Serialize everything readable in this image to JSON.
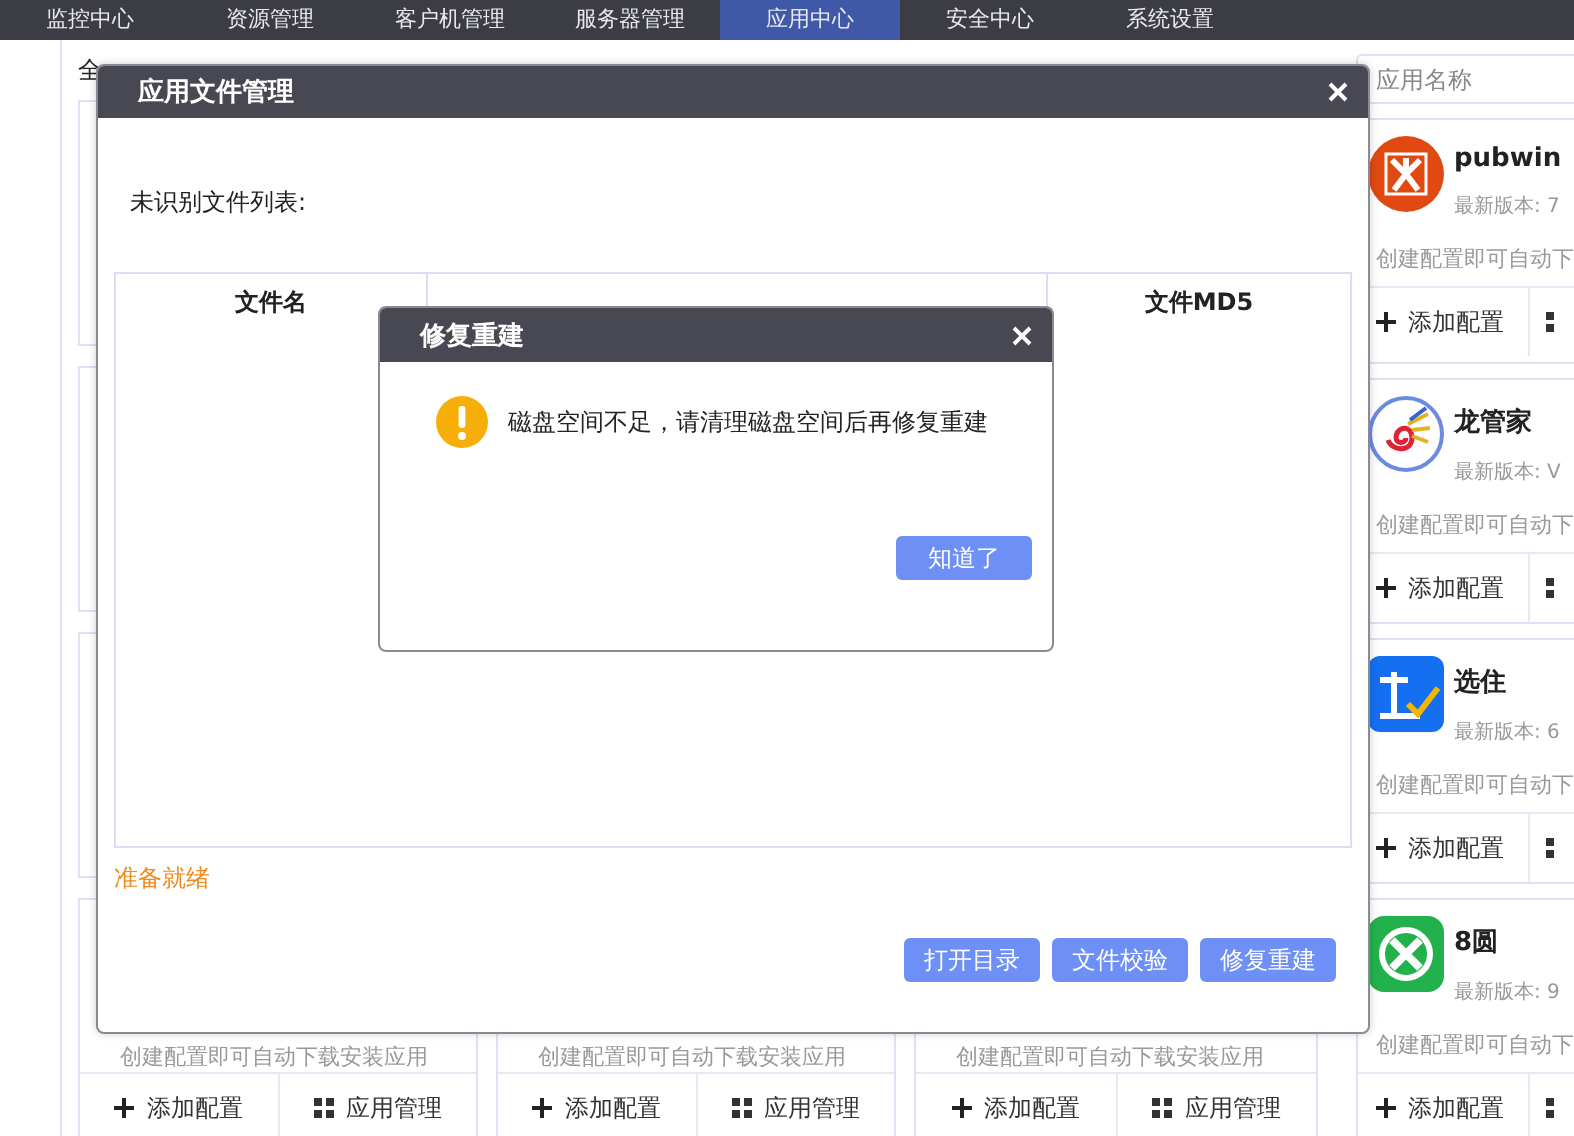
{
  "nav": {
    "items": [
      {
        "label": "监控中心",
        "selected": false
      },
      {
        "label": "资源管理",
        "selected": false
      },
      {
        "label": "客户机管理",
        "selected": false
      },
      {
        "label": "服务器管理",
        "selected": false
      },
      {
        "label": "应用中心",
        "selected": true
      },
      {
        "label": "安全中心",
        "selected": false
      },
      {
        "label": "系统设置",
        "selected": false
      }
    ]
  },
  "filter_label": "全",
  "back_cards": [
    {
      "description": "创建配置即可自动下载安装应用",
      "buttons": [
        "添加配置",
        "应用管理"
      ]
    },
    {
      "description": "创建配置即可自动下载安装应用",
      "buttons": [
        "添加配置",
        "应用管理"
      ]
    },
    {
      "description": "创建配置即可自动下载安装应用",
      "buttons": [
        "添加配置",
        "应用管理"
      ]
    }
  ],
  "search": {
    "placeholder": "应用名称"
  },
  "apps": [
    {
      "kind": "pubwin",
      "name": "pubwin",
      "version": "最新版本: 7",
      "description": "创建配置即可自动下",
      "button": "添加配置"
    },
    {
      "kind": "dragon",
      "name": "龙管家",
      "version": "最新版本: V",
      "description": "创建配置即可自动下",
      "button": "添加配置"
    },
    {
      "kind": "check",
      "name": "选住",
      "version": "最新版本: 6",
      "description": "创建配置即可自动下",
      "button": "添加配置"
    },
    {
      "kind": "green",
      "name": "8圆",
      "version": "最新版本: 9",
      "description": "创建配置即可自动下",
      "button": "添加配置"
    }
  ],
  "file_dialog": {
    "title": "应用文件管理",
    "list_label": "未识别文件列表:",
    "columns": [
      "文件名",
      null,
      "文件MD5"
    ],
    "status": "准备就绪",
    "buttons": [
      "打开目录",
      "文件校验",
      "修复重建"
    ]
  },
  "alert": {
    "title": "修复重建",
    "message": "磁盘空间不足，请清理磁盘空间后再修复重建",
    "button": "知道了"
  }
}
